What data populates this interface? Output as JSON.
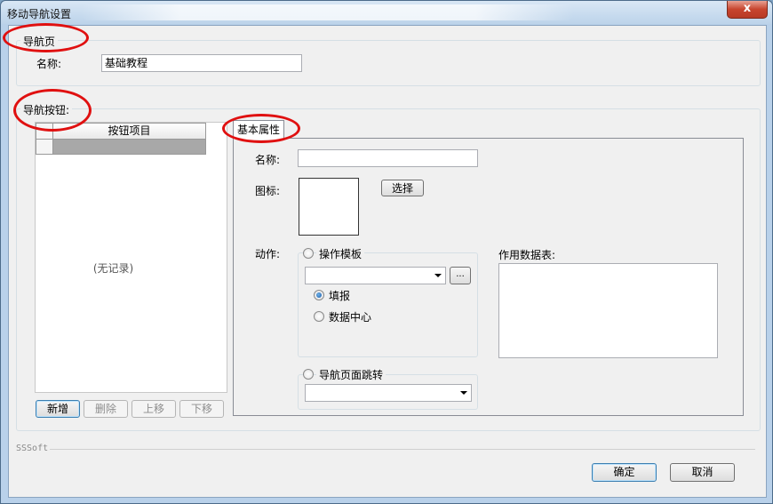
{
  "window": {
    "title": "移动导航设置",
    "close_glyph": "x"
  },
  "nav_page": {
    "group_label": "导航页",
    "name_label": "名称:",
    "name_value": "基础教程"
  },
  "nav_buttons": {
    "group_label": "导航按钮:",
    "grid_header": "按钮项目",
    "empty_text": "(无记录)",
    "buttons": {
      "add": "新增",
      "delete": "删除",
      "up": "上移",
      "down": "下移"
    }
  },
  "basic_props": {
    "tab_label": "基本属性",
    "name_label": "名称:",
    "name_value": "",
    "icon_label": "图标:",
    "select_button": "选择",
    "action_label": "动作:",
    "op_template_label": "操作模板",
    "op_template_value": "",
    "ellipsis": "...",
    "fill_report_label": "填报",
    "data_center_label": "数据中心",
    "nav_jump_label": "导航页面跳转",
    "nav_jump_value": "",
    "data_table_label": "作用数据表:"
  },
  "footer": {
    "brand": "SSSoft",
    "ok": "确定",
    "cancel": "取消"
  },
  "colors": {
    "annotation_red": "#e01010",
    "window_frame": "#b9d1ea",
    "client_bg": "#f0f0f0"
  }
}
